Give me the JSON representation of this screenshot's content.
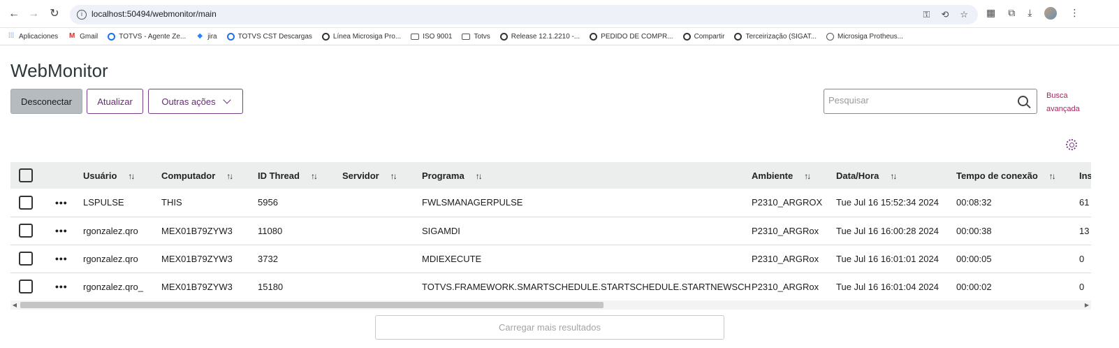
{
  "browser": {
    "url": "localhost:50494/webmonitor/main",
    "bookmarks": [
      {
        "label": "Aplicaciones",
        "icon": "apps-grid-icon"
      },
      {
        "label": "Gmail",
        "icon": "gmail-icon"
      },
      {
        "label": "TOTVS - Agente Ze...",
        "icon": "site-icon"
      },
      {
        "label": "jira",
        "icon": "jira-icon"
      },
      {
        "label": "TOTVS CST Descargas",
        "icon": "site-icon"
      },
      {
        "label": "Línea Microsiga Pro...",
        "icon": "site-icon"
      },
      {
        "label": "ISO 9001",
        "icon": "folder-icon"
      },
      {
        "label": "Totvs",
        "icon": "folder-icon"
      },
      {
        "label": "Release 12.1.2210 -...",
        "icon": "site-icon"
      },
      {
        "label": "PEDIDO DE COMPR...",
        "icon": "site-icon"
      },
      {
        "label": "Compartir",
        "icon": "site-icon"
      },
      {
        "label": "Terceirização (SIGAT...",
        "icon": "site-icon"
      },
      {
        "label": "Microsiga Protheus...",
        "icon": "globe-icon"
      }
    ]
  },
  "app": {
    "title": "WebMonitor",
    "toolbar": {
      "disconnect_label": "Desconectar",
      "refresh_label": "Atualizar",
      "other_actions_label": "Outras ações"
    },
    "search": {
      "placeholder": "Pesquisar",
      "advanced_line1": "Busca",
      "advanced_line2": "avançada"
    },
    "table": {
      "columns": [
        "Usuário",
        "Computador",
        "ID Thread",
        "Servidor",
        "Programa",
        "Ambiente",
        "Data/Hora",
        "Tempo de conexão",
        "Ins"
      ],
      "rows": [
        {
          "user": "LSPULSE",
          "computer": "THIS",
          "thread": "5956",
          "server": "",
          "program": "FWLSMANAGERPULSE",
          "env": "P2310_ARGROX",
          "datetime": "Tue Jul 16 15:52:34 2024",
          "conn_time": "00:08:32",
          "ins": "61"
        },
        {
          "user": "rgonzalez.qro",
          "computer": "MEX01B79ZYW3",
          "thread": "11080",
          "server": "",
          "program": "SIGAMDI",
          "env": "P2310_ARGRox",
          "datetime": "Tue Jul 16 16:00:28 2024",
          "conn_time": "00:00:38",
          "ins": "13"
        },
        {
          "user": "rgonzalez.qro",
          "computer": "MEX01B79ZYW3",
          "thread": "3732",
          "server": "",
          "program": "MDIEXECUTE",
          "env": "P2310_ARGRox",
          "datetime": "Tue Jul 16 16:01:01 2024",
          "conn_time": "00:00:05",
          "ins": "0"
        },
        {
          "user": "rgonzalez.qro_",
          "computer": "MEX01B79ZYW3",
          "thread": "15180",
          "server": "",
          "program": "TOTVS.FRAMEWORK.SMARTSCHEDULE.STARTSCHEDULE.STARTNEWSCHD",
          "env": "P2310_ARGRox",
          "datetime": "Tue Jul 16 16:01:04 2024",
          "conn_time": "00:00:02",
          "ins": "0"
        }
      ]
    },
    "load_more_label": "Carregar mais resultados",
    "colors": {
      "accent": "#7a3f86",
      "link": "#a2275d",
      "header_bg": "#eceded"
    }
  }
}
